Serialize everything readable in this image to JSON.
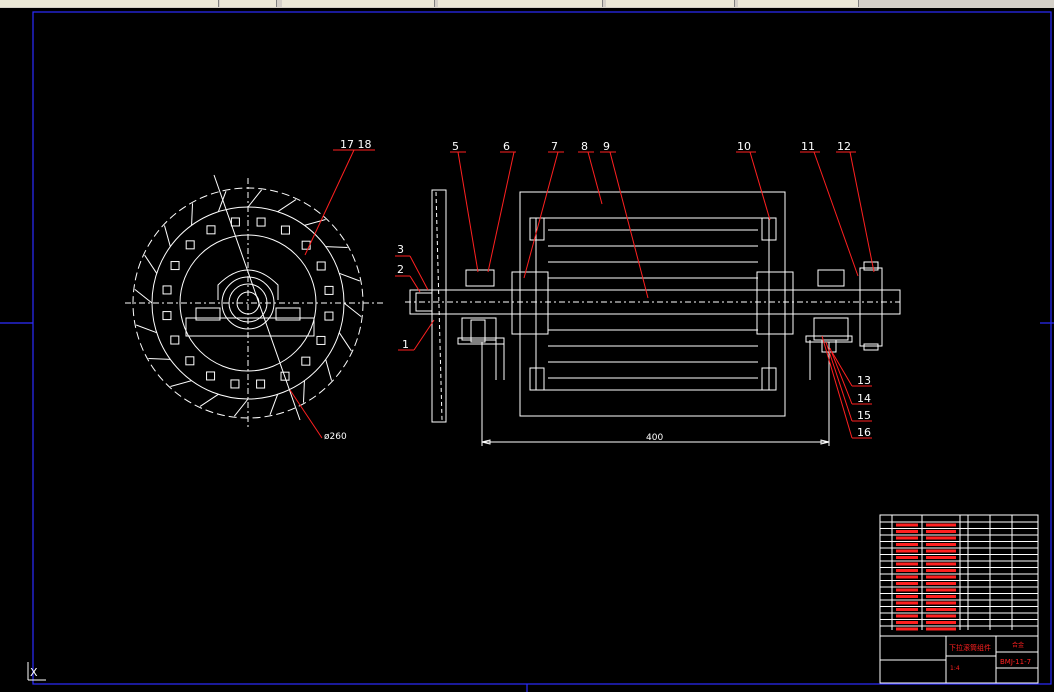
{
  "colors": {
    "background": "#000000",
    "leader": "#ff2020",
    "geometry": "#ffffff",
    "border": "#2c2cff"
  },
  "callouts": [
    "1",
    "2",
    "3",
    "5",
    "6",
    "7",
    "8",
    "9",
    "10",
    "11",
    "12",
    "13",
    "14",
    "15",
    "16"
  ],
  "callout_1718": "17 18",
  "diameter_label": "ø260",
  "length_dim": "400",
  "title_block": {
    "name": "下拉滚筒组件",
    "code": "BMJ-11-7",
    "scale": "1:4",
    "material_note": "合金"
  },
  "ucs_label": "X"
}
